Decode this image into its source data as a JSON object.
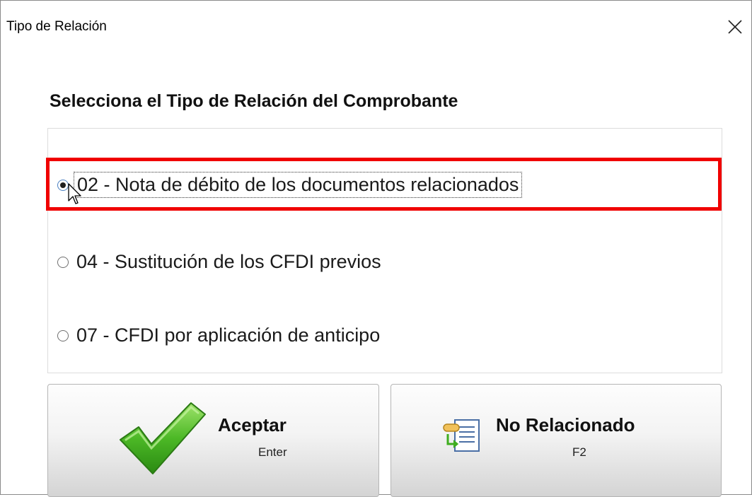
{
  "window": {
    "title": "Tipo de Relación"
  },
  "heading": "Selecciona el Tipo de Relación del Comprobante",
  "options": [
    {
      "label": "02 - Nota de débito de los documentos relacionados",
      "selected": true
    },
    {
      "label": "04 - Sustitución de los CFDI previos",
      "selected": false
    },
    {
      "label": "07 - CFDI por aplicación de anticipo",
      "selected": false
    }
  ],
  "buttons": {
    "accept": {
      "label": "Aceptar",
      "shortcut": "Enter",
      "icon": "checkmark-icon"
    },
    "no_related": {
      "label": "No Relacionado",
      "shortcut": "F2",
      "icon": "document-link-icon"
    }
  },
  "colors": {
    "highlight": "#f00000",
    "check_green": "#3fae1f",
    "radio_selected_border": "#4a7fc1"
  }
}
